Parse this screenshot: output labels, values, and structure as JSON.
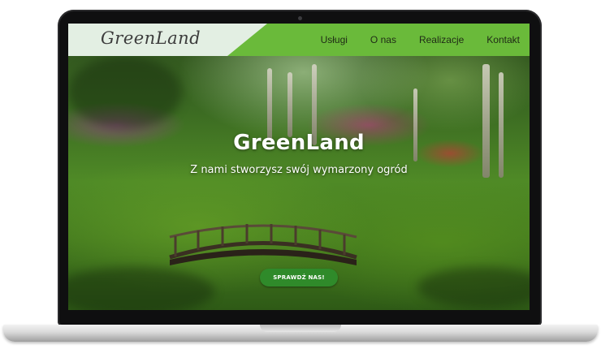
{
  "brand": {
    "logo_text": "GreenLand"
  },
  "nav": {
    "items": [
      {
        "label": "Usługi"
      },
      {
        "label": "O nas"
      },
      {
        "label": "Realizacje"
      },
      {
        "label": "Kontakt"
      }
    ]
  },
  "hero": {
    "title": "GreenLand",
    "subtitle": "Z nami stworzysz swój wymarzony ogród",
    "cta_label": "SPRAWDŹ NAS!"
  },
  "colors": {
    "navbar_green": "#6aba3a",
    "logo_panel": "#e3efe3",
    "cta_green": "#2f8a2a"
  }
}
